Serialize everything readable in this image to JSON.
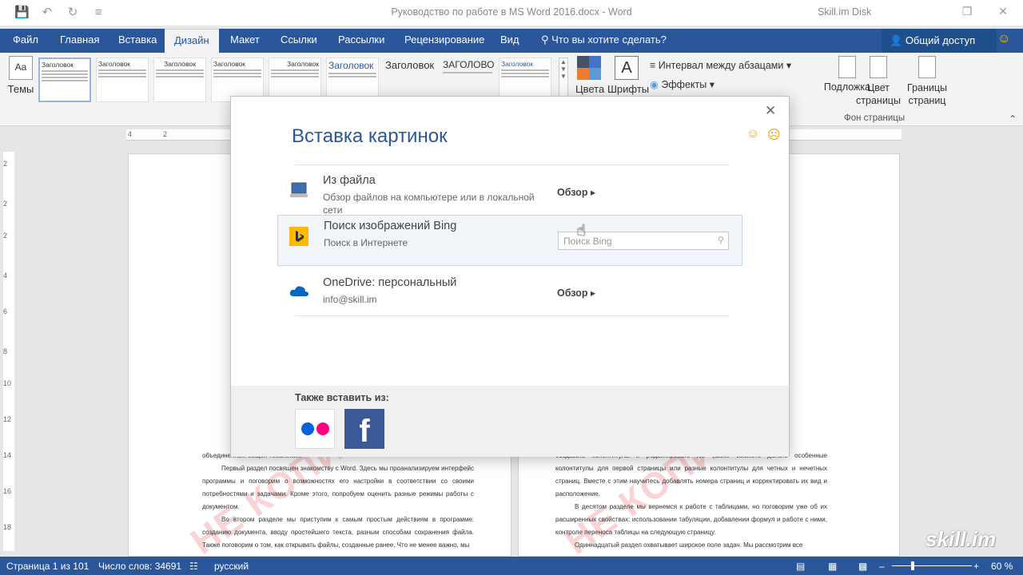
{
  "title_bar": {
    "doc_title": "Руководство по работе в MS Word 2016.docx - Word",
    "account": "Skill.im Disk"
  },
  "ribbon_tabs": [
    "Файл",
    "Главная",
    "Вставка",
    "Дизайн",
    "Макет",
    "Ссылки",
    "Рассылки",
    "Рецензирование",
    "Вид"
  ],
  "tell_me": "Что вы хотите сделать?",
  "share_label": "Общий доступ",
  "ribbon": {
    "themes_label": "Темы",
    "gallery_heading": "Заголовок",
    "gallery_heading_big": "Заголовок",
    "gallery_heading_caps": "ЗАГОЛОВОК",
    "colors_label": "Цвета",
    "fonts_label": "Шрифты",
    "paragraph_spacing": "Интервал между абзацами",
    "effects": "Эффекты",
    "watermark_label": "Подложка",
    "page_color_label": "Цвет страницы",
    "page_borders_label": "Границы страниц",
    "page_background_group": "Фон страницы"
  },
  "dialog": {
    "title": "Вставка картинок",
    "from_file": {
      "title": "Из файла",
      "subtitle": "Обзор файлов на компьютере или в локальной сети",
      "action": "Обзор"
    },
    "bing": {
      "title": "Поиск изображений Bing",
      "subtitle": "Поиск в Интернете",
      "search_placeholder": "Поиск Bing"
    },
    "onedrive": {
      "title": "OneDrive: персональный",
      "subtitle": "info@skill.im",
      "action": "Обзор"
    },
    "also_insert_from": "Также вставить из:"
  },
  "document": {
    "left_paragraphs": [
      "объединенных общей тематикой.",
      "Первый раздел посвящен знакомству с Word. Здесь мы проанализируем интерфейс программы и поговорим о возможностях его настройки в соответствии со своими потребностями и задачами. Кроме этого, попробуем оценить разные режимы работы с документом.",
      "Во втором разделе мы приступим к самым простым действиям в программе: созданию документа, вводу простейшего текста, разным способам сохранения файла. Также поговорим о том, как открывать файлы, созданные ранее. Что не менее важно, мы"
    ],
    "right_paragraphs": [
      "создавать колонтитулы и редактировать их. Также сможете делать особенные колонтитулы для первой страницы или разные колонтитулы для четных и нечетных страниц. Вместе с этим научитесь добавлять номера страниц и корректировать их вид и расположение.",
      "В десятом разделе мы вернемся к работе с таблицами, но поговорим уже об их расширенных свойствах: использовании табуляции, добавлении формул и работе с ними, контроле переноса таблицы на следующую страницу.",
      "Одиннадцатый раздел охватывает широкое поле задач. Мы рассмотрим все"
    ]
  },
  "status_bar": {
    "page": "Страница 1 из 101",
    "words": "Число слов: 34691",
    "language": "русский",
    "zoom": "60 %"
  },
  "colors": {
    "accent": "#2b579a",
    "bing_yellow": "#ffb900",
    "facebook": "#3b5998",
    "onedrive": "#0a64c2"
  }
}
